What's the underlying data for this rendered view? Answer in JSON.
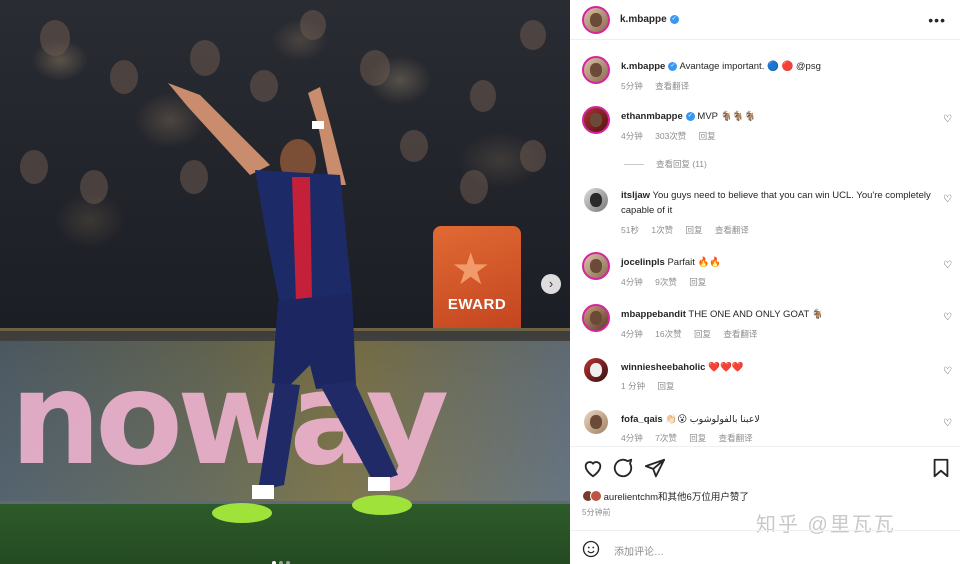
{
  "photo": {
    "board_text": "noway",
    "badge_text": "EWARD",
    "carousel_dots": 3,
    "active_dot": 0
  },
  "header": {
    "username": "k.mbappe",
    "more_label": "•••"
  },
  "caption": {
    "username": "k.mbappe",
    "text": "Avantage important. 🔵 🔴 @psg",
    "time": "5分钟",
    "translate": "查看翻译"
  },
  "comments": [
    {
      "username": "ethanmbappe",
      "verified": true,
      "text": "MVP 🐐🐐🐐",
      "time": "4分钟",
      "likes": "303次赞",
      "reply": "回复",
      "translate": ""
    },
    {
      "username": "itsljaw",
      "verified": false,
      "text": "You guys need to believe that you can win UCL. You're completely capable of it",
      "time": "51秒",
      "likes": "1次赞",
      "reply": "回复",
      "translate": "查看翻译"
    },
    {
      "username": "jocelinpls",
      "verified": false,
      "text": "Parfait 🔥🔥",
      "time": "4分钟",
      "likes": "9次赞",
      "reply": "回复",
      "translate": ""
    },
    {
      "username": "mbappebandit",
      "verified": false,
      "text": "THE ONE AND ONLY GOAT 🐐",
      "time": "4分钟",
      "likes": "16次赞",
      "reply": "回复",
      "translate": "查看翻译"
    },
    {
      "username": "winniesheebaholic",
      "verified": false,
      "text": "❤️❤️❤️",
      "time": "1 分钟",
      "likes": "",
      "reply": "回复",
      "translate": ""
    },
    {
      "username": "fofa_qais",
      "verified": false,
      "text": "👏🏻😮 لاعبنا بالفولوشوب",
      "time": "4分钟",
      "likes": "7次赞",
      "reply": "回复",
      "translate": "查看翻译"
    }
  ],
  "view_replies": "查看回复 (11)",
  "likes": {
    "text": "aurelientchm和其他6万位用户赞了"
  },
  "post_time": "5分钟前",
  "add_comment_placeholder": "添加评论…",
  "watermark": "知乎 @里瓦瓦"
}
